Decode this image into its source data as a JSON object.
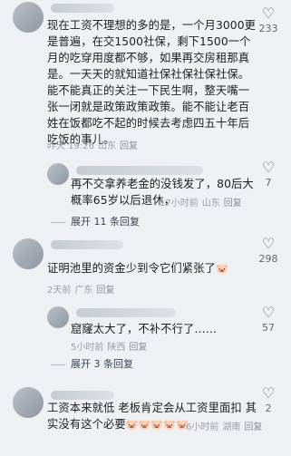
{
  "comments": [
    {
      "text": "现在工资不理想的多的是，一个月3000更是普遍，在交1500社保，剩下1500一个月的吃穿用度都不够，如果再交房租那真是。一天天的就知道社保社保社保社保。能不能真正的关注一下民生啊，整天嘴一张一闭就是政策政策政策。能不能让老百姓在饭都吃不起的时候去考虑四五十年后吃饭的事儿。",
      "time": "昨天 19:26",
      "location": "山东",
      "reply": "回复",
      "likes": "233",
      "expand": ""
    },
    {
      "text": "再不交拿养老金的没钱发了，80后大概率65岁以后退休，",
      "time": "17小时前",
      "location": "山东",
      "reply": "回复",
      "likes": "7",
      "expand": "展开 11 条回复"
    },
    {
      "text": "证明池里的资金少到令它们紧张了",
      "emoji": "🐷",
      "time": "2天前",
      "location": "广东",
      "reply": "回复",
      "likes": "298",
      "expand": ""
    },
    {
      "text": "窟窿太大了，不补不行了……",
      "time": "5小时前",
      "location": "陕西",
      "reply": "回复",
      "likes": "57",
      "expand": "展开 3 条回复"
    },
    {
      "text": "工资本来就低 老板肯定会从工资里面扣 其实没有这个必要",
      "emoji": "🐷🐷🐷🐷🐷",
      "time": "6小时前",
      "location": "湖南",
      "reply": "回复",
      "likes": "2",
      "expand": ""
    }
  ],
  "icons": {
    "like": "heart-outline-icon"
  }
}
